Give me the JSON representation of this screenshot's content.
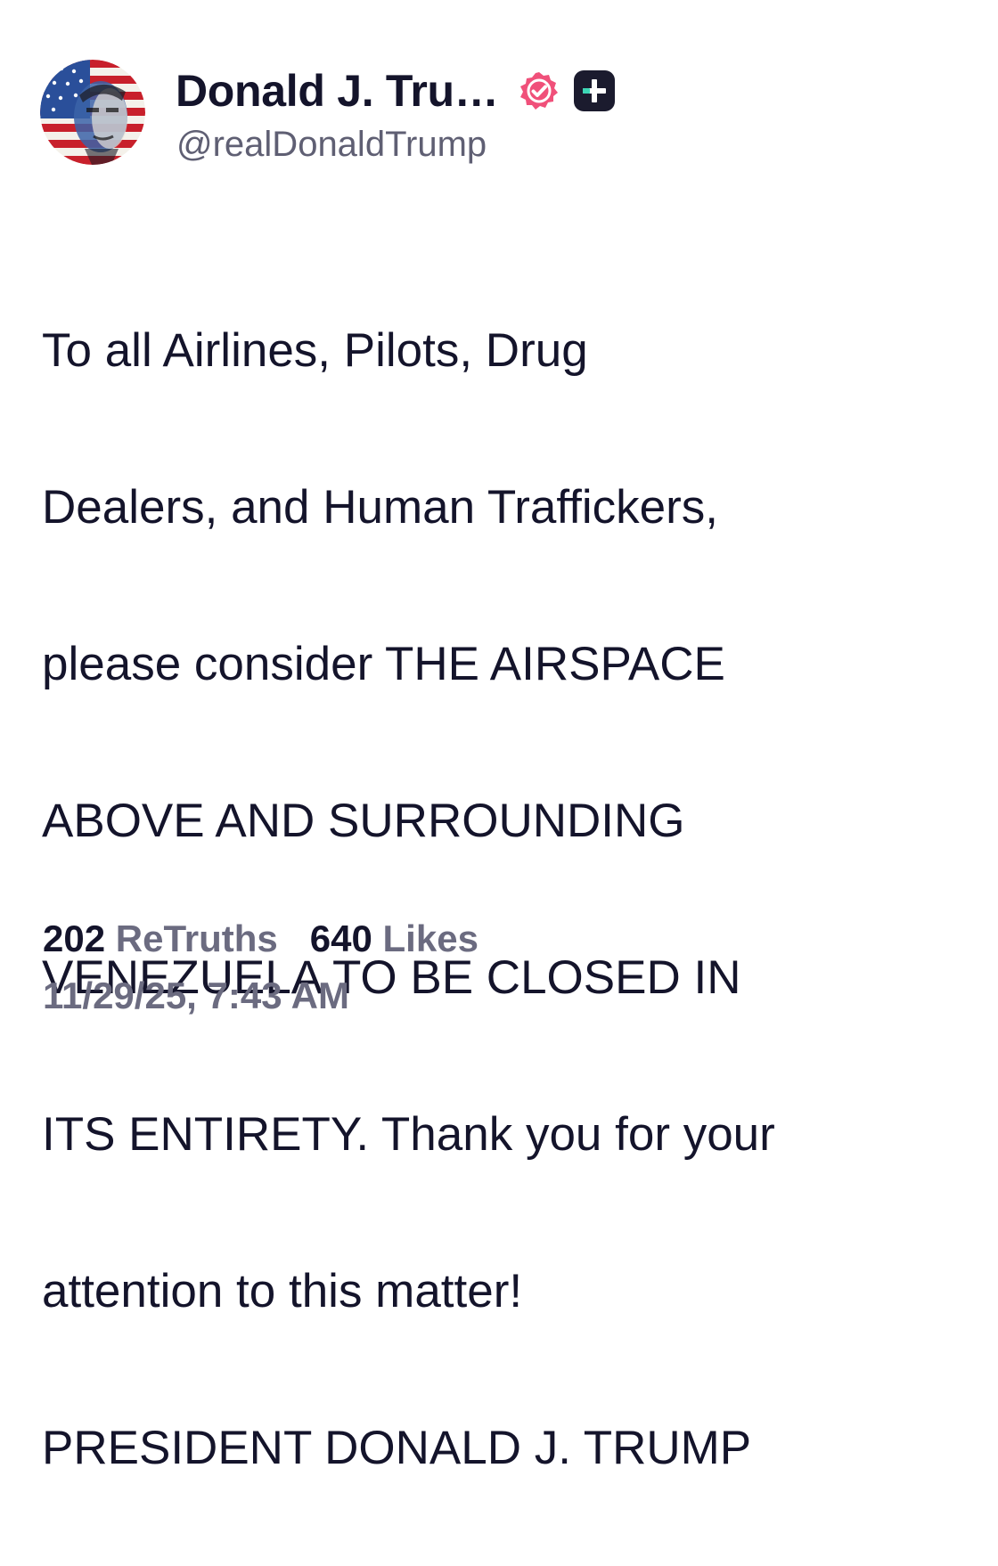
{
  "author": {
    "display_name": "Donald J. Tru…",
    "handle": "@realDonaldTrump",
    "avatar": "stars-and-stripes-portrait",
    "verified_icon": "verified-check-icon",
    "badge_icon": "plus-badge-icon"
  },
  "post": {
    "lines": [
      "To all Airlines, Pilots, Drug",
      "Dealers, and Human Traffickers,",
      "please consider THE AIRSPACE",
      "ABOVE AND SURROUNDING",
      "VENEZUELA TO BE CLOSED IN",
      "ITS ENTIRETY. Thank you for your",
      "attention to this matter!",
      "PRESIDENT DONALD J. TRUMP"
    ]
  },
  "stats": {
    "retruths_count": "202",
    "retruths_label": "ReTruths",
    "likes_count": "640",
    "likes_label": "Likes"
  },
  "timestamp": "11/29/25, 7:43 AM",
  "colors": {
    "text": "#14142b",
    "muted": "#6b6b80",
    "verified": "#f0507a",
    "badge_bg": "#1b1b2e",
    "badge_accent": "#3dd6b5"
  }
}
